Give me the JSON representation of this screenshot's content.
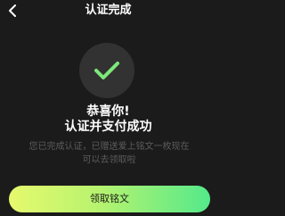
{
  "nav": {
    "title": "认证完成",
    "back_icon": "chevron-left-icon"
  },
  "status": {
    "icon": "checkmark-icon",
    "line1": "恭喜你!",
    "line2": "认证并支付成功"
  },
  "description": {
    "line1": "您已完成认证，已赠送爱上铭文一枚现在",
    "line2": "可以去领取啦"
  },
  "cta": {
    "label": "领取铭文"
  },
  "colors": {
    "background": "#1b1b1b",
    "check_accent": "#7de87a",
    "cta_gradient_start": "#e6f96d",
    "cta_gradient_end": "#54e98a",
    "muted_text": "#5c5c5c"
  }
}
